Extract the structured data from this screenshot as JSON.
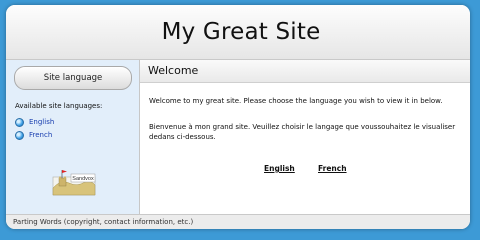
{
  "site": {
    "title": "My Great Site"
  },
  "sidebar": {
    "button_label": "Site language",
    "available_label": "Available site languages:",
    "languages": [
      {
        "label": "English",
        "icon": "globe-bullet-icon"
      },
      {
        "label": "French",
        "icon": "globe-bullet-icon"
      }
    ],
    "badge_text": "Sandvox"
  },
  "main": {
    "title": "Welcome",
    "paragraph_en": "Welcome to my great site.  Please choose the language you wish to view it in below.",
    "paragraph_fr": "Bienvenue à mon grand site. Veuillez choisir le langage que voussouhaitez le visualiser dedans ci-dessous.",
    "links": [
      {
        "label": "English"
      },
      {
        "label": "French"
      }
    ]
  },
  "footer": {
    "text": "Parting Words (copyright, contact information, etc.)"
  },
  "colors": {
    "background": "#3d9ad6",
    "sidebar_bg": "#e2eefa",
    "link": "#1a3fb0"
  }
}
